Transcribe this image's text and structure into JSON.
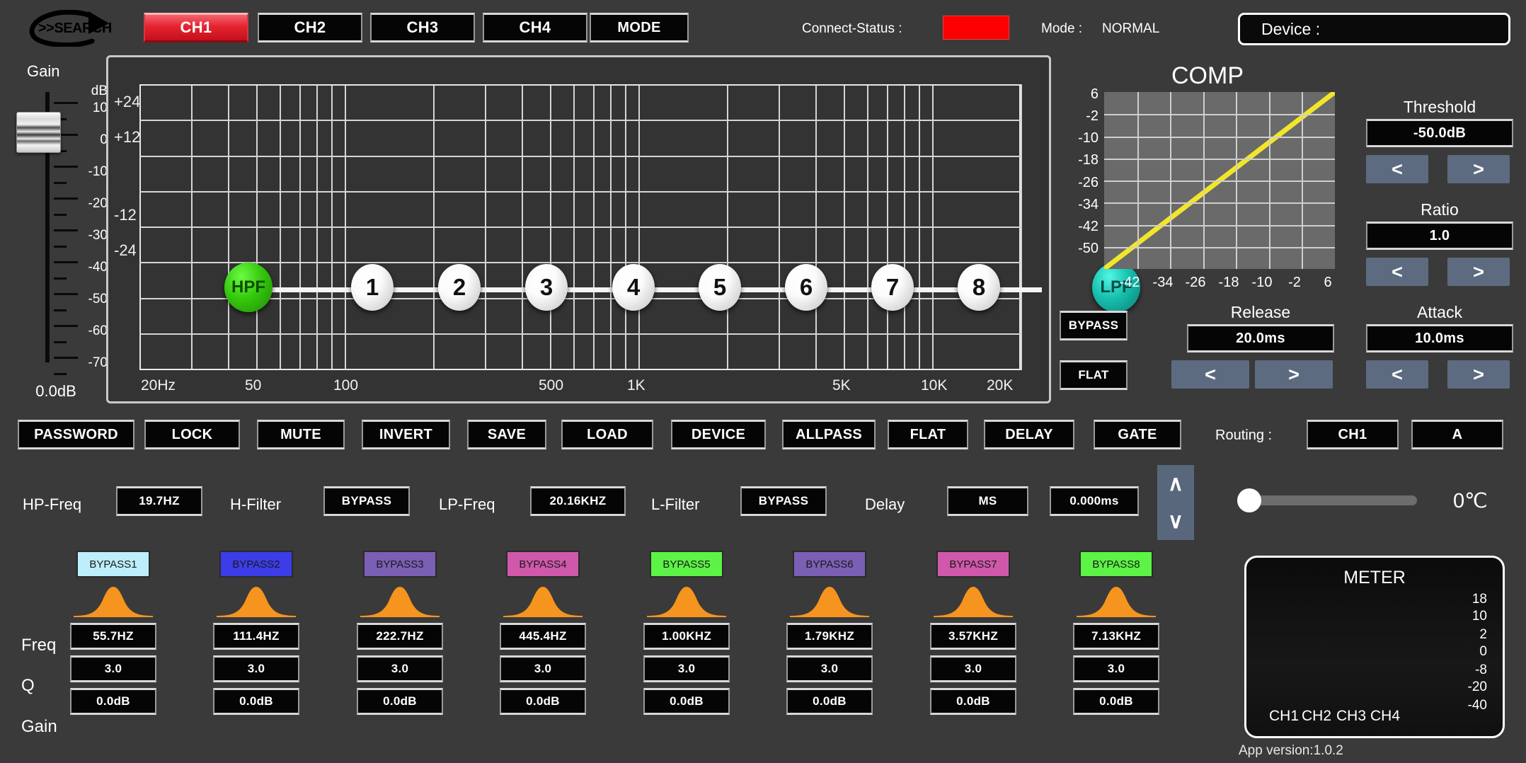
{
  "header": {
    "search_label": ">>SEARCH",
    "search_icon": "rotate-arrow-icon",
    "channels": [
      {
        "label": "CH1",
        "active": true
      },
      {
        "label": "CH2",
        "active": false
      },
      {
        "label": "CH3",
        "active": false
      },
      {
        "label": "CH4",
        "active": false
      }
    ],
    "mode_button": "MODE",
    "connect_status_label": "Connect-Status :",
    "connect_status_color": "#fe0000",
    "mode_label": "Mode :",
    "mode_value": "NORMAL",
    "device_label": "Device :"
  },
  "gain_fader": {
    "title": "Gain",
    "unit": "dB",
    "ticks": [
      "10",
      "0",
      "-10",
      "-20",
      "-30",
      "-40",
      "-50",
      "-60",
      "-70"
    ],
    "value": "0.0dB"
  },
  "eq": {
    "y_labels": [
      "+24",
      "+12",
      "-12",
      "-24"
    ],
    "x_labels": [
      "20Hz",
      "50",
      "100",
      "500",
      "1K",
      "5K",
      "10K",
      "20K"
    ],
    "hpf_label": "HPF",
    "lpf_label": "LPF",
    "hpf_color": "#35c90d",
    "lpf_color": "#17bfae",
    "nodes": [
      "1",
      "2",
      "3",
      "4",
      "5",
      "6",
      "7",
      "8"
    ]
  },
  "chart_data": {
    "type": "line",
    "title": "COMP",
    "xlabel": "",
    "ylabel": "",
    "x_ticks": [
      -42,
      -34,
      -26,
      -18,
      -10,
      -2,
      6
    ],
    "y_ticks": [
      6,
      -2,
      -10,
      -18,
      -26,
      -34,
      -42,
      -50
    ],
    "xlim": [
      -50,
      6
    ],
    "ylim": [
      -50,
      6
    ],
    "grid": true,
    "legend": "none",
    "series": [
      {
        "name": "transfer-curve",
        "color": "#f2e62a",
        "x": [
          -50,
          6
        ],
        "y": [
          -50,
          6
        ]
      }
    ]
  },
  "comp_controls": {
    "threshold": {
      "label": "Threshold",
      "value": "-50.0dB",
      "dec": "<",
      "inc": ">"
    },
    "ratio": {
      "label": "Ratio",
      "value": "1.0",
      "dec": "<",
      "inc": ">"
    },
    "release": {
      "label": "Release",
      "value": "20.0ms",
      "dec": "<",
      "inc": ">"
    },
    "attack": {
      "label": "Attack",
      "value": "10.0ms",
      "dec": "<",
      "inc": ">"
    },
    "bypass_button": "BYPASS",
    "flat_button": "FLAT"
  },
  "function_buttons": [
    "PASSWORD",
    "LOCK",
    "MUTE",
    "INVERT",
    "SAVE",
    "LOAD",
    "DEVICE",
    "ALLPASS",
    "FLAT",
    "DELAY",
    "GATE"
  ],
  "routing": {
    "label": "Routing :",
    "channel": "CH1",
    "output": "A"
  },
  "filter_row": {
    "hp_freq_label": "HP-Freq",
    "hp_freq_value": "19.7HZ",
    "h_filter_label": "H-Filter",
    "h_filter_value": "BYPASS",
    "lp_freq_label": "LP-Freq",
    "lp_freq_value": "20.16KHZ",
    "l_filter_label": "L-Filter",
    "l_filter_value": "BYPASS",
    "delay_label": "Delay",
    "delay_unit": "MS",
    "delay_value": "0.000ms",
    "spin_up": "∧",
    "spin_down": "∨",
    "temperature": "0℃"
  },
  "peq": {
    "row_labels": {
      "freq": "Freq",
      "q": "Q",
      "gain": "Gain"
    },
    "bands": [
      {
        "button": "BYPASS1",
        "color": "#bdeefb",
        "freq": "55.7HZ",
        "q": "3.0",
        "gain": "0.0dB"
      },
      {
        "button": "BYPASS2",
        "color": "#3c3ce8",
        "freq": "111.4HZ",
        "q": "3.0",
        "gain": "0.0dB"
      },
      {
        "button": "BYPASS3",
        "color": "#7b5fb4",
        "freq": "222.7HZ",
        "q": "3.0",
        "gain": "0.0dB"
      },
      {
        "button": "BYPASS4",
        "color": "#cf58ab",
        "freq": "445.4HZ",
        "q": "3.0",
        "gain": "0.0dB"
      },
      {
        "button": "BYPASS5",
        "color": "#5cf246",
        "freq": "1.00KHZ",
        "q": "3.0",
        "gain": "0.0dB"
      },
      {
        "button": "BYPASS6",
        "color": "#7b5fb4",
        "freq": "1.79KHZ",
        "q": "3.0",
        "gain": "0.0dB"
      },
      {
        "button": "BYPASS7",
        "color": "#cf58ab",
        "freq": "3.57KHZ",
        "q": "3.0",
        "gain": "0.0dB"
      },
      {
        "button": "BYPASS8",
        "color": "#5cf246",
        "freq": "7.13KHZ",
        "q": "3.0",
        "gain": "0.0dB"
      }
    ],
    "curve_color": "#f5941e"
  },
  "meter": {
    "title": "METER",
    "scale": [
      "18",
      "10",
      "2",
      "0",
      "-8",
      "-20",
      "-40"
    ],
    "channels": [
      "CH1",
      "CH2",
      "CH3",
      "CH4"
    ]
  },
  "footer": {
    "app_version": "App version:1.0.2"
  }
}
